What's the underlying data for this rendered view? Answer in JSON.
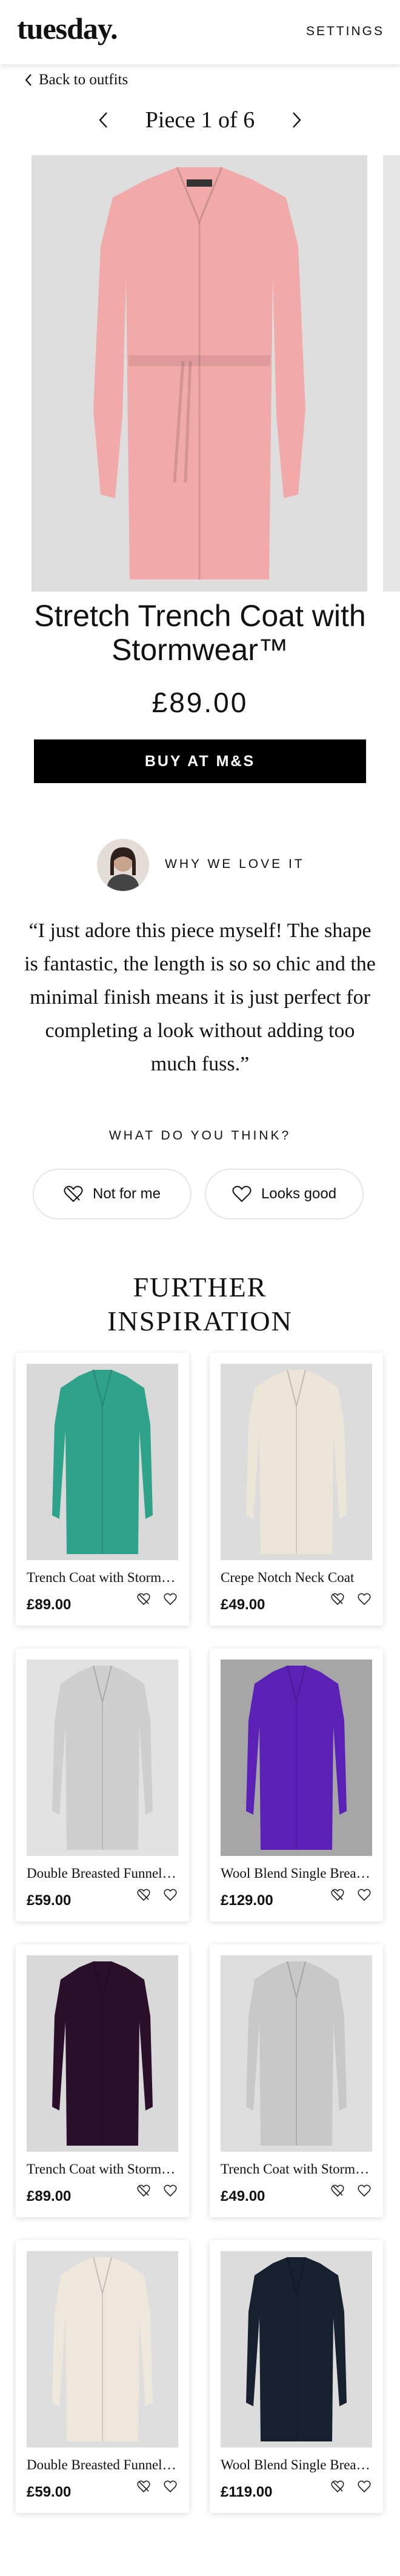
{
  "header": {
    "logo": "tuesday.",
    "settings_label": "SETTINGS"
  },
  "nav": {
    "back_label": "Back to outfits",
    "pager_label": "Piece 1 of 6"
  },
  "product": {
    "title": "Stretch Trench Coat with Stormwear™",
    "price": "£89.00",
    "buy_label": "BUY AT M&S",
    "coat_color": "#f2a9a9"
  },
  "why": {
    "label": "WHY WE LOVE IT",
    "quote": "“I just adore this piece myself! The shape is fantastic, the length is so so chic and the minimal finish means it is just perfect for completing a look without adding too much fuss.”"
  },
  "feedback": {
    "question": "WHAT DO YOU THINK?",
    "not_label": "Not for me",
    "good_label": "Looks good"
  },
  "inspiration": {
    "title_line1": "FURTHER",
    "title_line2": "INSPIRATION",
    "items": [
      {
        "name": "Trench Coat with Stormwear™",
        "price": "£89.00",
        "color": "#2fa38a",
        "bg": "#d9d9d9"
      },
      {
        "name": "Crepe Notch Neck Coat",
        "price": "£49.00",
        "color": "#ece6d8",
        "bg": "#dcdcdc"
      },
      {
        "name": "Double Breasted Funnel Neck Coat",
        "price": "£59.00",
        "color": "#cfcfcf",
        "bg": "#e2e2e2"
      },
      {
        "name": "Wool Blend Single Breasted Coat",
        "price": "£129.00",
        "color": "#5b21b6",
        "bg": "#a6a6a6"
      },
      {
        "name": "Trench Coat with Stormwear™",
        "price": "£89.00",
        "color": "#2a0f2a",
        "bg": "#d9d9d9"
      },
      {
        "name": "Trench Coat with Stormwear™",
        "price": "£49.00",
        "color": "#c8c8c8",
        "bg": "#dedede"
      },
      {
        "name": "Double Breasted Funnel Neck Coat",
        "price": "£59.00",
        "color": "#eee8dc",
        "bg": "#dedede"
      },
      {
        "name": "Wool Blend Single Breasted Coat",
        "price": "£119.00",
        "color": "#17202e",
        "bg": "#dcdcdc"
      }
    ]
  }
}
